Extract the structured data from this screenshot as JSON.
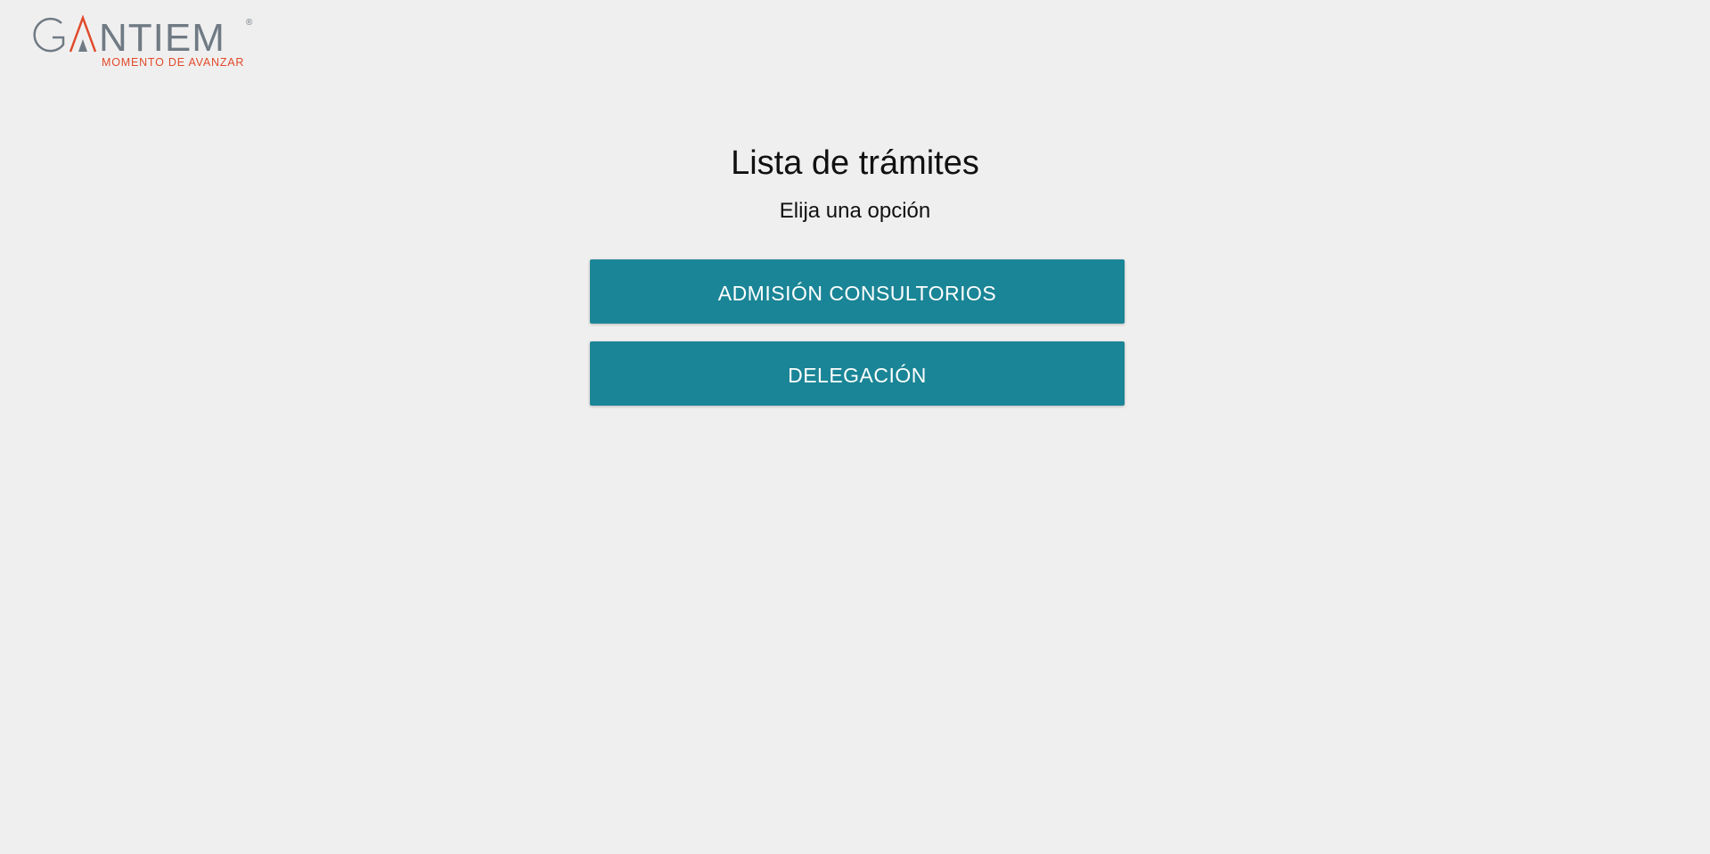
{
  "header": {
    "logo": {
      "wordmark": "GANTIEM",
      "registered_mark": "®",
      "tagline": "MOMENTO DE AVANZAR",
      "wordmark_color": "#6f7a84",
      "accent_color": "#e04a2b"
    }
  },
  "main": {
    "title": "Lista de trámites",
    "subtitle": "Elija una opción",
    "options": [
      {
        "label": "ADMISIÓN CONSULTORIOS"
      },
      {
        "label": "DELEGACIÓN"
      }
    ]
  },
  "colors": {
    "background": "#f0efef",
    "button_bg": "#1a8596",
    "button_text": "#ffffff"
  }
}
